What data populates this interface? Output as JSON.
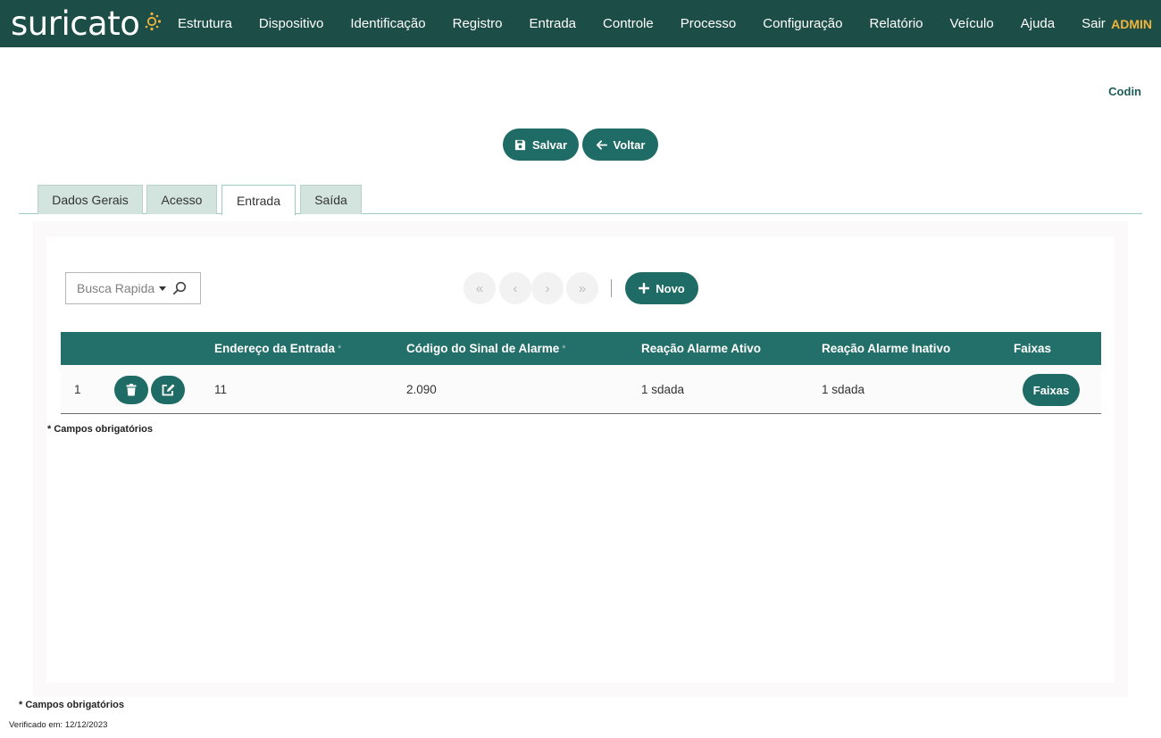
{
  "brand": {
    "logo_text": "suricato",
    "accent_color": "#f0b43c",
    "primary_color": "#1d4d47",
    "button_color": "#1f6b65"
  },
  "nav": {
    "items": [
      {
        "label": "Estrutura",
        "name": "nav-estrutura"
      },
      {
        "label": "Dispositivo",
        "name": "nav-dispositivo"
      },
      {
        "label": "Identificação",
        "name": "nav-identificacao"
      },
      {
        "label": "Registro",
        "name": "nav-registro"
      },
      {
        "label": "Entrada",
        "name": "nav-entrada"
      },
      {
        "label": "Controle",
        "name": "nav-controle"
      },
      {
        "label": "Processo",
        "name": "nav-processo"
      },
      {
        "label": "Configuração",
        "name": "nav-configuracao"
      },
      {
        "label": "Relatório",
        "name": "nav-relatorio"
      },
      {
        "label": "Veículo",
        "name": "nav-veiculo"
      },
      {
        "label": "Ajuda",
        "name": "nav-ajuda"
      },
      {
        "label": "Sair",
        "name": "nav-sair"
      }
    ],
    "user": "ADMIN"
  },
  "page": {
    "record_label": "Codin"
  },
  "actions": {
    "save_label": "Salvar",
    "back_label": "Voltar"
  },
  "tabs": [
    {
      "label": "Dados Gerais",
      "active": false
    },
    {
      "label": "Acesso",
      "active": false
    },
    {
      "label": "Entrada",
      "active": true
    },
    {
      "label": "Saída",
      "active": false
    }
  ],
  "toolbar": {
    "search_placeholder": "Busca Rapida",
    "pager": {
      "first": "«",
      "prev": "‹",
      "next": "›",
      "last": "»"
    },
    "new_label": "Novo"
  },
  "table": {
    "columns": [
      {
        "label": "Endereço da Entrada",
        "required": "*"
      },
      {
        "label": "Código do Sinal de Alarme",
        "required": "*"
      },
      {
        "label": "Reação Alarme Ativo",
        "required": ""
      },
      {
        "label": "Reação Alarme Inativo",
        "required": ""
      },
      {
        "label": "Faixas",
        "required": ""
      }
    ],
    "rows": [
      {
        "index": "1",
        "endereco": "11",
        "codigo": "2.090",
        "ativo": "1 sdada",
        "inativo": "1 sdada",
        "faixas_label": "Faixas"
      }
    ]
  },
  "notes": {
    "required_inner": "* Campos obrigatórios",
    "required_outer": "* Campos obrigatórios",
    "verified": "Verificado em: 12/12/2023"
  },
  "icons": {
    "save": "floppy-disk-icon",
    "back": "arrow-left-icon",
    "new": "plus-icon",
    "delete": "trash-icon",
    "edit": "edit-icon",
    "search": "magnifier-icon"
  }
}
